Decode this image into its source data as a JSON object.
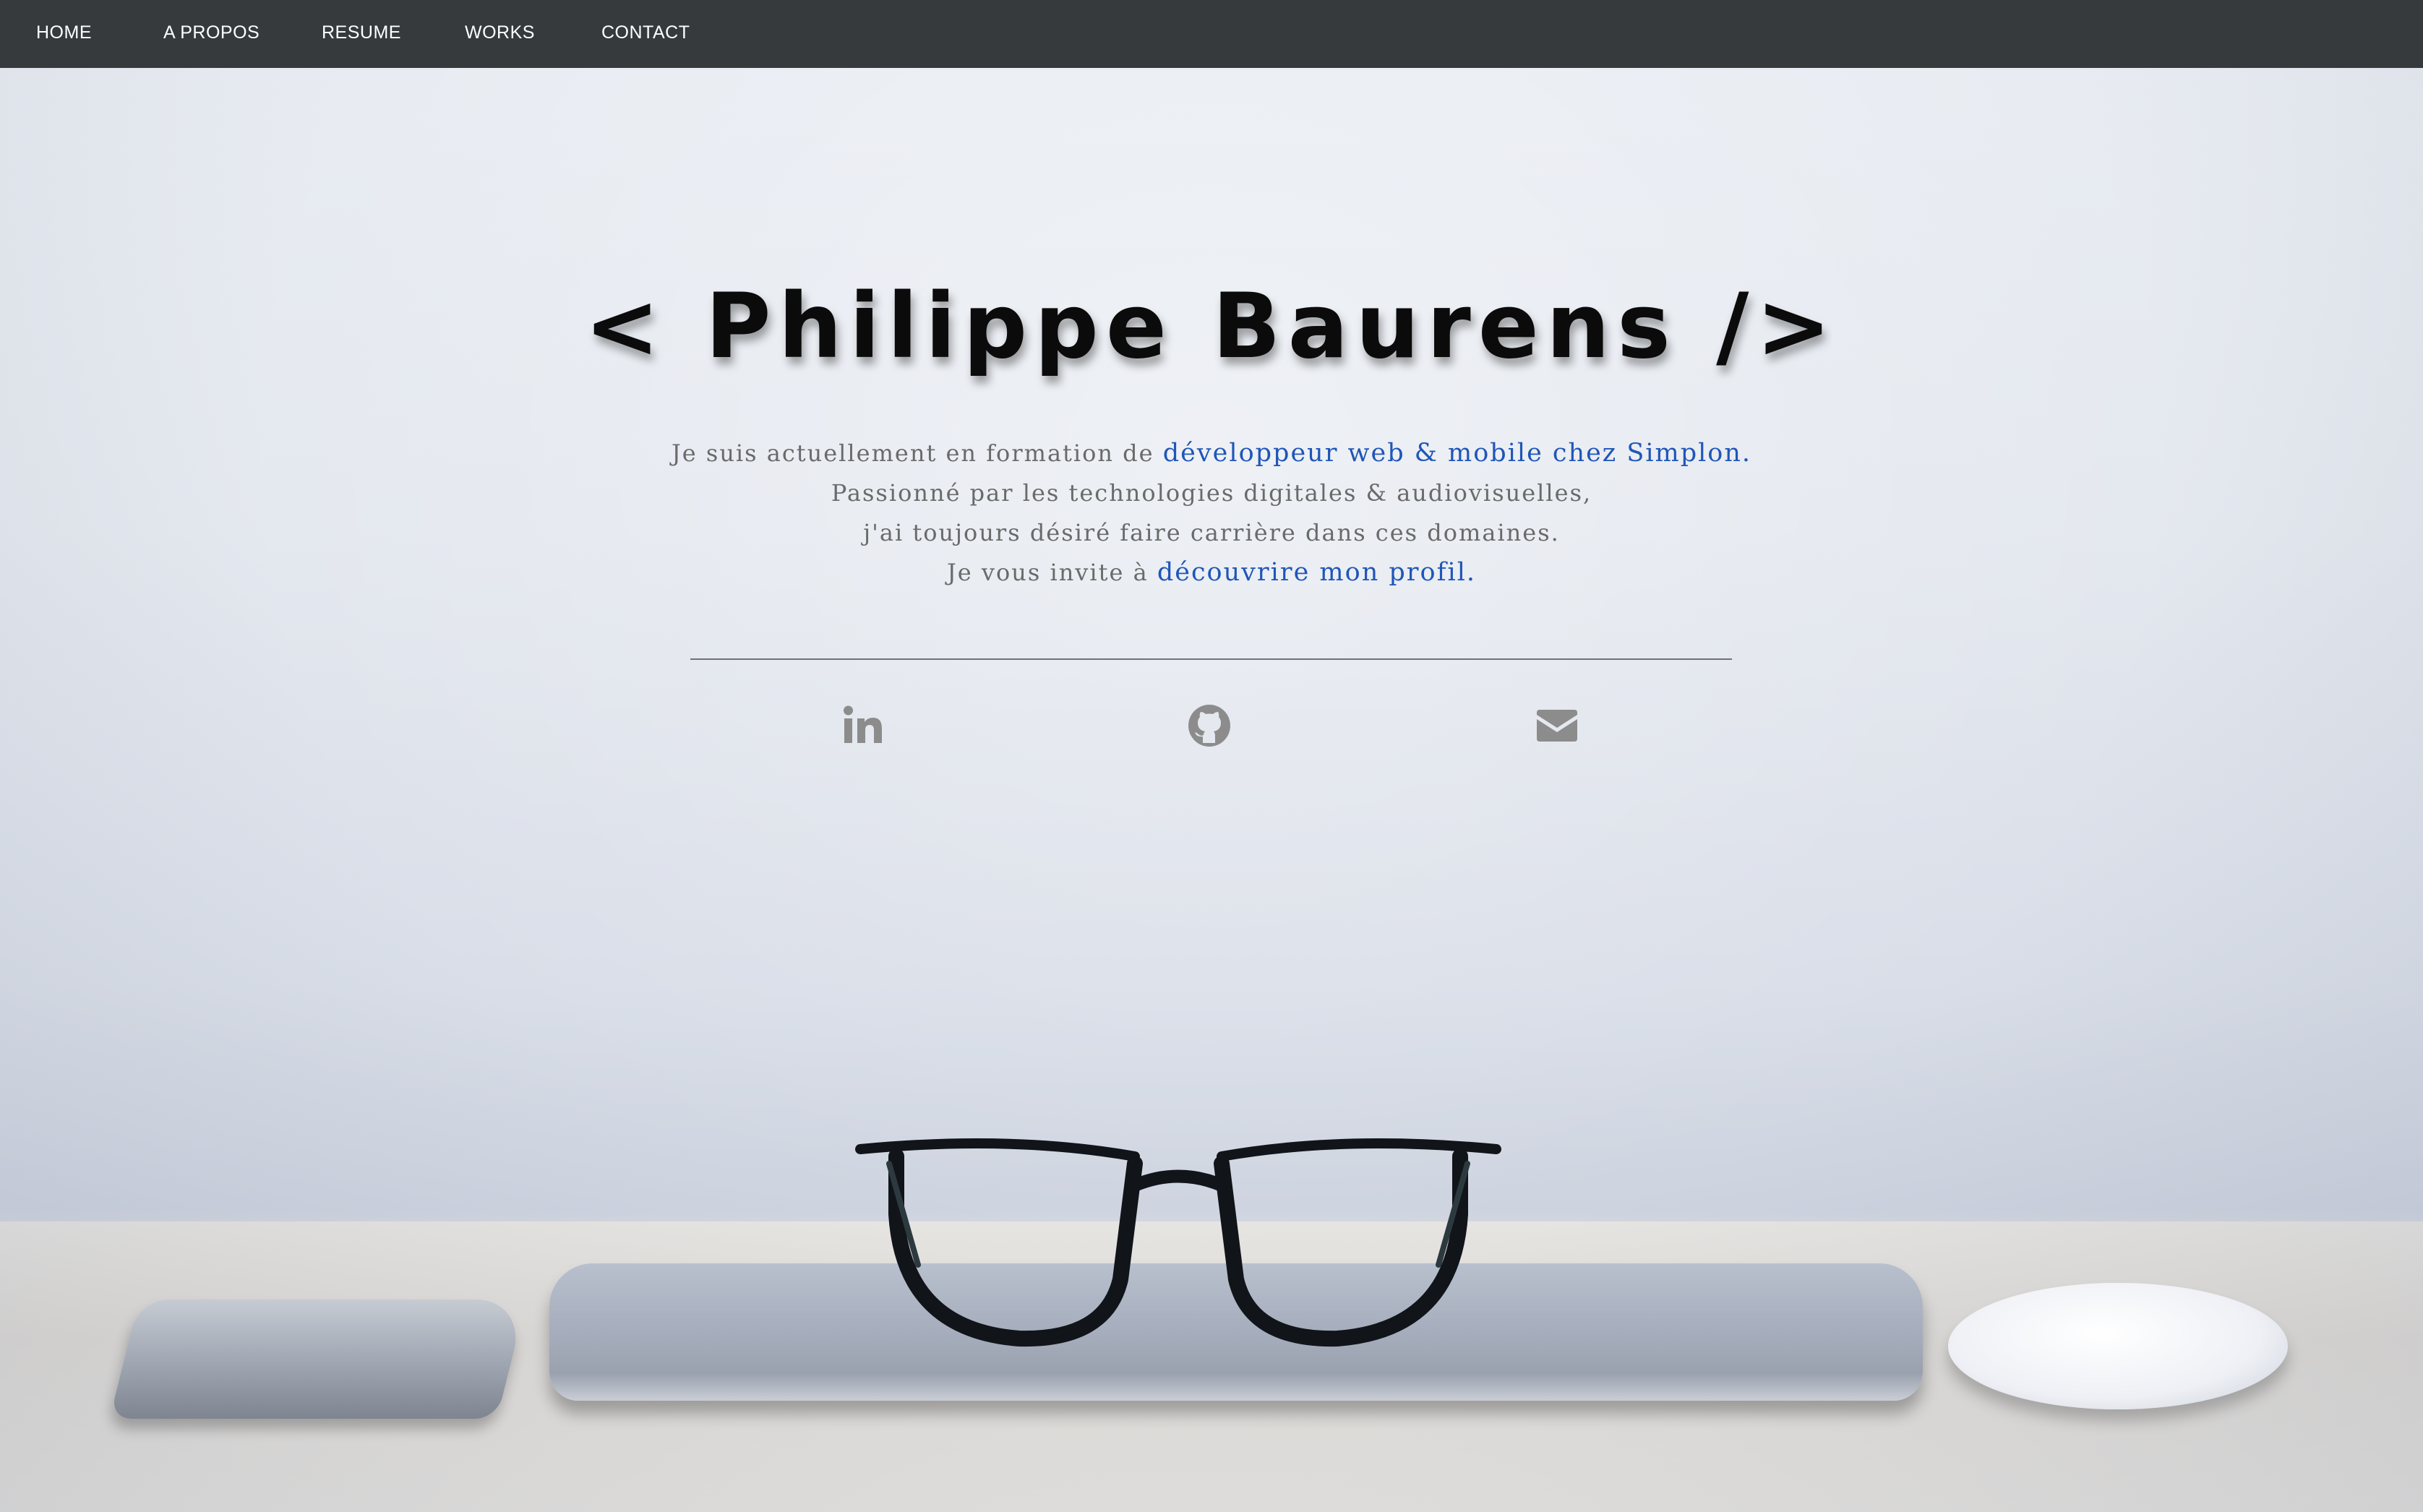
{
  "nav": {
    "items": [
      {
        "label": "HOME"
      },
      {
        "label": "A PROPOS"
      },
      {
        "label": "RESUME"
      },
      {
        "label": "WORKS"
      },
      {
        "label": "CONTACT"
      }
    ]
  },
  "hero": {
    "title": "< Philippe Baurens />",
    "intro": {
      "line1_text": "Je suis actuellement en formation de ",
      "line1_link": "développeur web & mobile chez Simplon.",
      "line2": "Passionné par les technologies digitales & audiovisuelles,",
      "line3": "j'ai toujours désiré faire carrière dans ces domaines.",
      "line4_text": "Je vous invite à ",
      "line4_link": "découvrire mon profil."
    },
    "social": [
      {
        "icon": "linkedin-icon"
      },
      {
        "icon": "github-icon"
      },
      {
        "icon": "envelope-icon"
      }
    ]
  },
  "colors": {
    "navbar": "#363a3d",
    "accent_link": "#1f56b8",
    "body_text": "#6a6a6a",
    "icon": "#8c8c8c"
  }
}
